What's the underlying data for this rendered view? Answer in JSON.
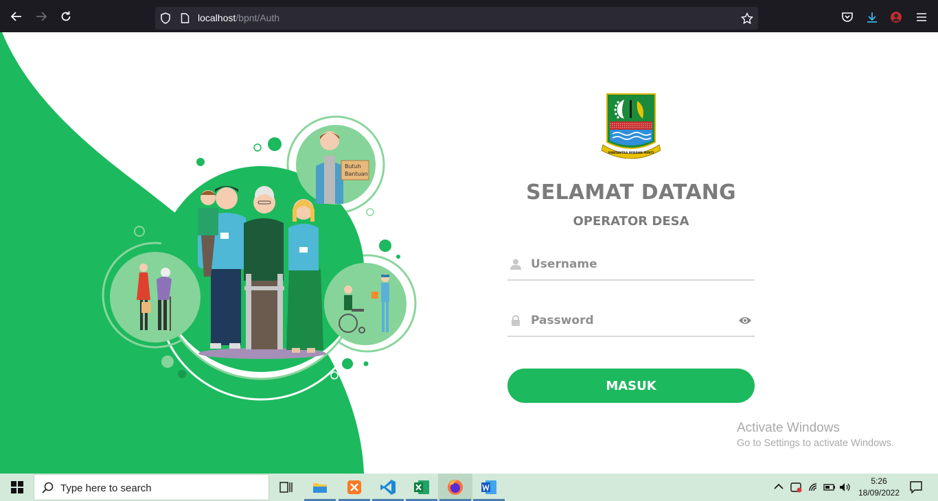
{
  "browser": {
    "url_host": "localhost",
    "url_path": "/bpnt/Auth"
  },
  "page": {
    "title": "SELAMAT DATANG",
    "subtitle": "OPERATOR DESA",
    "username_placeholder": "Username",
    "password_placeholder": "Password",
    "submit_label": "MASUK",
    "illustration_sign": [
      "Butuh",
      "Bantuan"
    ],
    "logo_motto": "SWATANTRA WIBAWA MUKTI",
    "accent_color": "#1db95e",
    "accent_light": "#86d49a"
  },
  "watermark": {
    "title": "Activate Windows",
    "subtitle": "Go to Settings to activate Windows."
  },
  "taskbar": {
    "search_placeholder": "Type here to search",
    "time": "5:26",
    "date": "18/09/2022",
    "apps": [
      "task-view",
      "file-explorer",
      "xampp",
      "vscode",
      "excel",
      "firefox",
      "word"
    ]
  }
}
